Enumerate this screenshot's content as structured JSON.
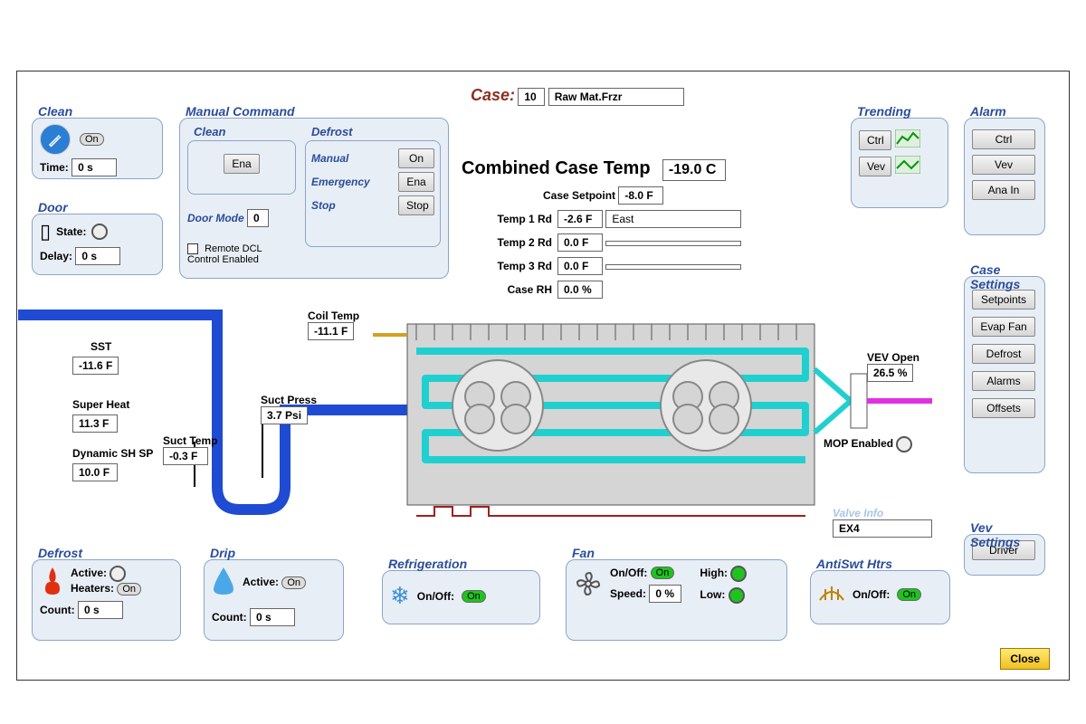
{
  "header": {
    "case_label": "Case:",
    "case_num": "10",
    "case_name": "Raw Mat.Frzr"
  },
  "clean": {
    "title": "Clean",
    "on": "On",
    "time_label": "Time:",
    "time_val": "0 s"
  },
  "door": {
    "title": "Door",
    "state_label": "State:",
    "delay_label": "Delay:",
    "delay_val": "0 s"
  },
  "manual": {
    "title": "Manual Command",
    "clean_title": "Clean",
    "ena": "Ena",
    "defrost_title": "Defrost",
    "manual_label": "Manual",
    "on": "On",
    "emergency_label": "Emergency",
    "ena2": "Ena",
    "stop_label": "Stop",
    "stop": "Stop",
    "door_mode_label": "Door Mode",
    "door_mode_val": "0",
    "remote_label": "Remote DCL Control Enabled"
  },
  "temps": {
    "combined_label": "Combined Case Temp",
    "combined_val": "-19.0 C",
    "setpoint_label": "Case Setpoint",
    "setpoint_val": "-8.0 F",
    "t1_label": "Temp 1 Rd",
    "t1_val": "-2.6 F",
    "t1_name": "East",
    "t2_label": "Temp 2 Rd",
    "t2_val": "0.0 F",
    "t2_name": "",
    "t3_label": "Temp 3 Rd",
    "t3_val": "0.0 F",
    "t3_name": "",
    "rh_label": "Case RH",
    "rh_val": "0.0 %"
  },
  "trending": {
    "title": "Trending",
    "ctrl": "Ctrl",
    "vev": "Vev"
  },
  "alarm": {
    "title": "Alarm",
    "ctrl": "Ctrl",
    "vev": "Vev",
    "ana": "Ana In"
  },
  "case_settings": {
    "title": "Case Settings",
    "setpoints": "Setpoints",
    "evap": "Evap Fan",
    "defrost": "Defrost",
    "alarms": "Alarms",
    "offsets": "Offsets"
  },
  "vev_settings": {
    "title": "Vev Settings",
    "driver": "Driver"
  },
  "coil": {
    "label": "Coil Temp",
    "val": "-11.1 F"
  },
  "sst": {
    "label": "SST",
    "val": "-11.6 F"
  },
  "superheat": {
    "label": "Super Heat",
    "val": "11.3 F"
  },
  "dynsh": {
    "label": "Dynamic SH SP",
    "val": "10.0 F"
  },
  "suct_temp": {
    "label": "Suct Temp",
    "val": "-0.3 F"
  },
  "suct_press": {
    "label": "Suct Press",
    "val": "3.7 Psi"
  },
  "vev": {
    "label": "VEV Open",
    "val": "26.5 %",
    "mop_label": "MOP Enabled"
  },
  "valve_info": {
    "title": "Valve Info",
    "val": "EX4"
  },
  "defrost": {
    "title": "Defrost",
    "active_label": "Active:",
    "heaters_label": "Heaters:",
    "heaters_val": "On",
    "count_label": "Count:",
    "count_val": "0 s"
  },
  "drip": {
    "title": "Drip",
    "active_label": "Active:",
    "active_val": "On",
    "count_label": "Count:",
    "count_val": "0 s"
  },
  "refrig": {
    "title": "Refrigeration",
    "onoff_label": "On/Off:",
    "onoff_val": "On"
  },
  "fan": {
    "title": "Fan",
    "onoff_label": "On/Off:",
    "onoff_val": "On",
    "speed_label": "Speed:",
    "speed_val": "0 %",
    "high_label": "High:",
    "low_label": "Low:"
  },
  "antiswt": {
    "title": "AntiSwt Htrs",
    "onoff_label": "On/Off:",
    "onoff_val": "On"
  },
  "close": "Close"
}
